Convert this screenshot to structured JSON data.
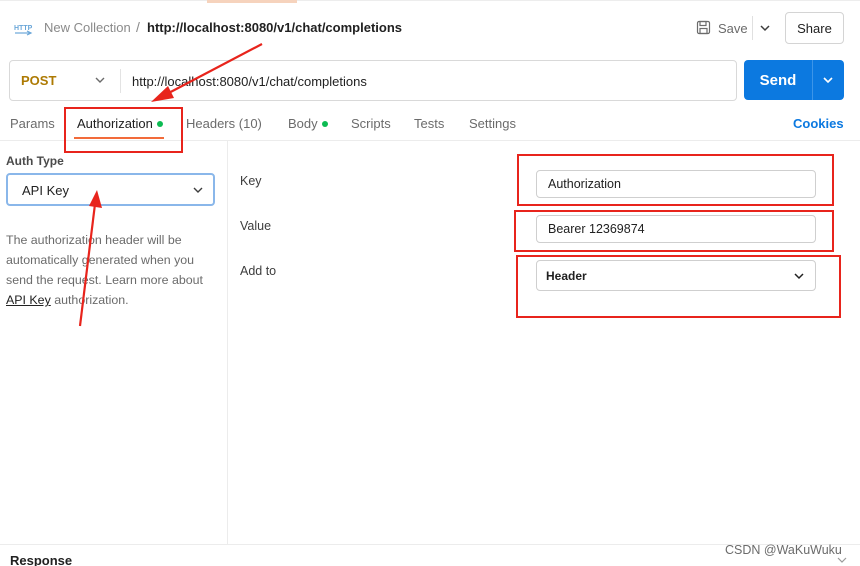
{
  "header": {
    "collection": "New Collection",
    "separator": "/",
    "request_name": "http://localhost:8080/v1/chat/completions",
    "save_label": "Save",
    "share_label": "Share",
    "http_icon": "http-icon"
  },
  "request": {
    "method": "POST",
    "url": "http://localhost:8080/v1/chat/completions",
    "send_label": "Send"
  },
  "tabs": [
    {
      "label": "Params"
    },
    {
      "label": "Authorization",
      "dot": true,
      "active": true
    },
    {
      "label": "Headers",
      "count": "(10)"
    },
    {
      "label": "Body",
      "dot": true
    },
    {
      "label": "Scripts"
    },
    {
      "label": "Tests"
    },
    {
      "label": "Settings"
    }
  ],
  "cookies_label": "Cookies",
  "auth": {
    "type_label": "Auth Type",
    "type_value": "API Key",
    "desc_before": "The authorization header will be automatically generated when you send the request. Learn more about ",
    "desc_link": "API Key",
    "desc_after": " authorization."
  },
  "fields": {
    "key_label": "Key",
    "key_value": "Authorization",
    "value_label": "Value",
    "value_value": "Bearer 12369874",
    "addto_label": "Add to",
    "addto_value": "Header"
  },
  "response_label": "Response",
  "watermark": "CSDN @WaKuWuku",
  "colors": {
    "accent": "#0c79e0",
    "method": "#ad7a03",
    "active_tab_underline": "#f26b3a",
    "dot": "#0cbb52",
    "annotation": "#e8241c"
  }
}
